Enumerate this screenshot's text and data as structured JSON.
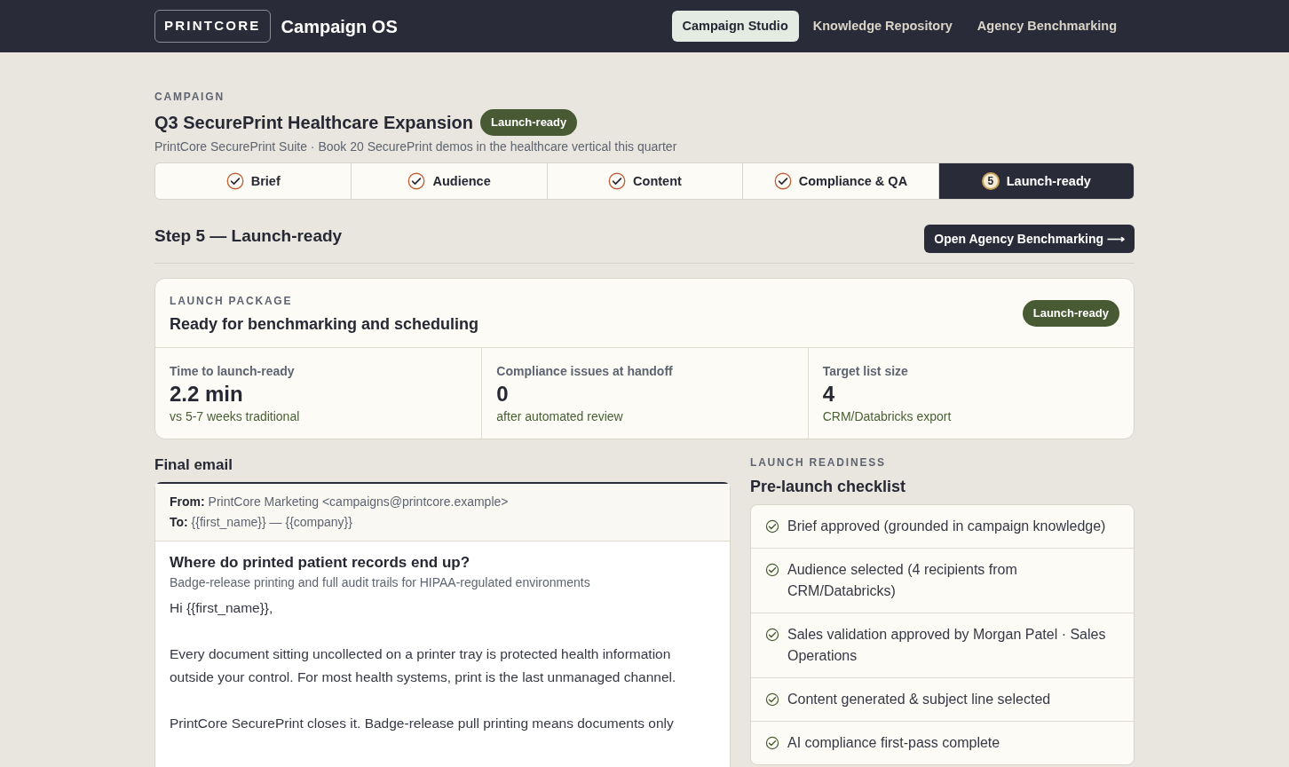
{
  "header": {
    "logo": "PRINTCORE",
    "app_name": "Campaign OS",
    "nav": [
      {
        "label": "Campaign Studio",
        "selected": true
      },
      {
        "label": "Knowledge Repository",
        "selected": false
      },
      {
        "label": "Agency Benchmarking",
        "selected": false
      }
    ]
  },
  "campaign": {
    "eyebrow": "CAMPAIGN",
    "title": "Q3 SecurePrint Healthcare Expansion",
    "badge": "Launch-ready",
    "subtitle": "PrintCore SecurePrint Suite · Book 20 SecurePrint demos in the healthcare vertical this quarter"
  },
  "steps": [
    {
      "label": "Brief",
      "kind": "done",
      "selected": false
    },
    {
      "label": "Audience",
      "kind": "done",
      "selected": false
    },
    {
      "label": "Content",
      "kind": "done",
      "selected": false
    },
    {
      "label": "Compliance & QA",
      "kind": "done",
      "selected": false
    },
    {
      "label": "Launch-ready",
      "kind": "current",
      "number": "5",
      "selected": true
    }
  ],
  "step_title": "Step 5 — Launch-ready",
  "step_button": "Open Agency Benchmarking ⟶",
  "package": {
    "eyebrow": "LAUNCH PACKAGE",
    "title": "Ready for benchmarking and scheduling",
    "badge": "Launch-ready",
    "metrics": [
      {
        "label": "Time to launch-ready",
        "value": "2.2 min",
        "note": "vs 5-7 weeks traditional"
      },
      {
        "label": "Compliance issues at handoff",
        "value": "0",
        "note": "after automated review"
      },
      {
        "label": "Target list size",
        "value": "4",
        "note": "CRM/Databricks export"
      }
    ]
  },
  "email": {
    "heading": "Final email",
    "from_label": "From:",
    "from": "PrintCore Marketing <campaigns@printcore.example>",
    "to_label": "To:",
    "to": "{{first_name}} — {{company}}",
    "subject": "Where do printed patient records end up?",
    "preheader": "Badge-release printing and full audit trails for HIPAA-regulated environments",
    "body": [
      "Hi {{first_name}},",
      "Every document sitting uncollected on a printer tray is protected health information outside your control. For most health systems, print is the last unmanaged channel.",
      "PrintCore SecurePrint closes it. Badge-release pull printing means documents only"
    ]
  },
  "checklist": {
    "eyebrow": "LAUNCH READINESS",
    "title": "Pre-launch checklist",
    "items": [
      {
        "label": "Brief approved (grounded in campaign knowledge)",
        "checked": true
      },
      {
        "label": "Audience selected (4 recipients from CRM/Databricks)",
        "checked": true
      },
      {
        "label": "Sales validation approved by Morgan Patel · Sales Operations",
        "checked": true
      },
      {
        "label": "Content generated & subject line selected",
        "checked": true
      },
      {
        "label": "AI compliance first-pass complete",
        "checked": true
      }
    ]
  }
}
